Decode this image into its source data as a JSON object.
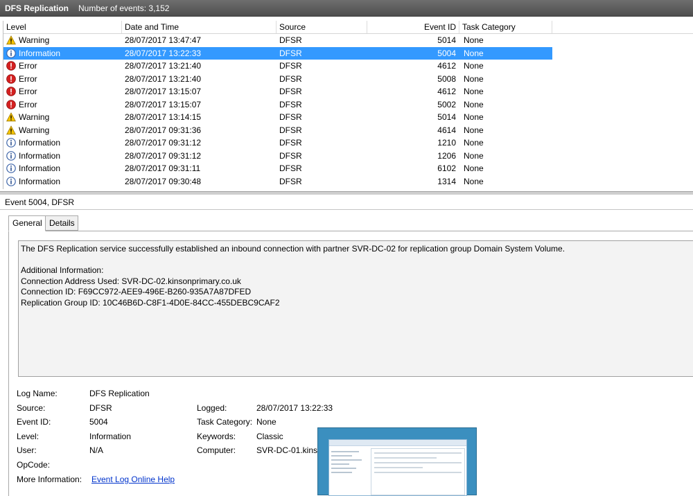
{
  "window": {
    "title": "DFS Replication",
    "event_count": "Number of events: 3,152"
  },
  "columns": {
    "level": "Level",
    "date": "Date and Time",
    "source": "Source",
    "event_id": "Event ID",
    "task": "Task Category"
  },
  "events": [
    {
      "icon": "warning-icon",
      "level": "Warning",
      "date": "28/07/2017 13:47:47",
      "source": "DFSR",
      "event_id": "5014",
      "task": "None"
    },
    {
      "icon": "information-icon",
      "level": "Information",
      "date": "28/07/2017 13:22:33",
      "source": "DFSR",
      "event_id": "5004",
      "task": "None",
      "selected": true
    },
    {
      "icon": "error-icon",
      "level": "Error",
      "date": "28/07/2017 13:21:40",
      "source": "DFSR",
      "event_id": "4612",
      "task": "None"
    },
    {
      "icon": "error-icon",
      "level": "Error",
      "date": "28/07/2017 13:21:40",
      "source": "DFSR",
      "event_id": "5008",
      "task": "None"
    },
    {
      "icon": "error-icon",
      "level": "Error",
      "date": "28/07/2017 13:15:07",
      "source": "DFSR",
      "event_id": "4612",
      "task": "None"
    },
    {
      "icon": "error-icon",
      "level": "Error",
      "date": "28/07/2017 13:15:07",
      "source": "DFSR",
      "event_id": "5002",
      "task": "None"
    },
    {
      "icon": "warning-icon",
      "level": "Warning",
      "date": "28/07/2017 13:14:15",
      "source": "DFSR",
      "event_id": "5014",
      "task": "None"
    },
    {
      "icon": "warning-icon",
      "level": "Warning",
      "date": "28/07/2017 09:31:36",
      "source": "DFSR",
      "event_id": "4614",
      "task": "None"
    },
    {
      "icon": "information-icon",
      "level": "Information",
      "date": "28/07/2017 09:31:12",
      "source": "DFSR",
      "event_id": "1210",
      "task": "None"
    },
    {
      "icon": "information-icon",
      "level": "Information",
      "date": "28/07/2017 09:31:12",
      "source": "DFSR",
      "event_id": "1206",
      "task": "None"
    },
    {
      "icon": "information-icon",
      "level": "Information",
      "date": "28/07/2017 09:31:11",
      "source": "DFSR",
      "event_id": "6102",
      "task": "None"
    },
    {
      "icon": "information-icon",
      "level": "Information",
      "date": "28/07/2017 09:30:48",
      "source": "DFSR",
      "event_id": "1314",
      "task": "None"
    }
  ],
  "detail": {
    "header": "Event 5004, DFSR",
    "tabs": {
      "general": "General",
      "details": "Details"
    },
    "description": {
      "line1": "The DFS Replication service successfully established an inbound connection with partner SVR-DC-02 for replication group Domain System Volume.",
      "line2": "Additional Information:",
      "line3": "Connection Address Used: SVR-DC-02.kinsonprimary.co.uk",
      "line4": "Connection ID: F69CC972-AEE9-496E-B260-935A7A87DFED",
      "line5": "Replication Group ID: 10C46B6D-C8F1-4D0E-84CC-455DEBC9CAF2"
    },
    "fields": {
      "log_name_label": "Log Name:",
      "log_name": "DFS Replication",
      "source_label": "Source:",
      "source": "DFSR",
      "logged_label": "Logged:",
      "logged": "28/07/2017 13:22:33",
      "event_id_label": "Event ID:",
      "event_id": "5004",
      "task_label": "Task Category:",
      "task": "None",
      "level_label": "Level:",
      "level": "Information",
      "keywords_label": "Keywords:",
      "keywords": "Classic",
      "user_label": "User:",
      "user": "N/A",
      "computer_label": "Computer:",
      "computer": "SVR-DC-01.kinso",
      "opcode_label": "OpCode:",
      "more_info_label": "More Information:",
      "more_info_link": "Event Log Online Help"
    }
  },
  "colors": {
    "selection": "#3399ff",
    "titlebar": "#5a5a5a",
    "link": "#0033cc"
  }
}
